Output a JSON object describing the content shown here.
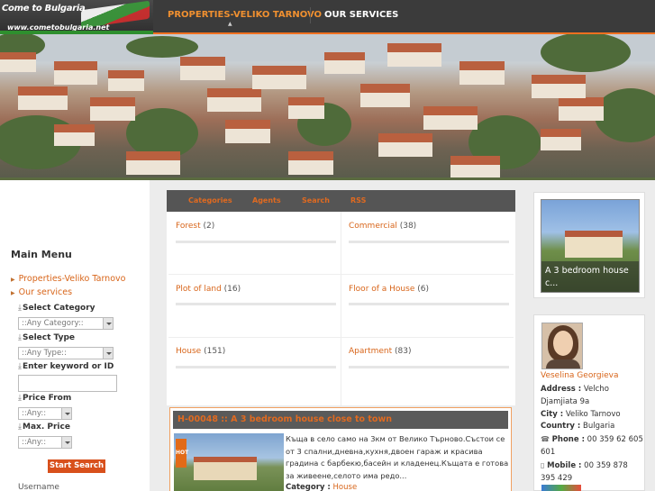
{
  "logo": {
    "line1": "Come to Bulgaria",
    "line2": "www.cometobulgaria.net"
  },
  "nav": {
    "items": [
      "PROPERTIES-VELIKO TARNOVO",
      "OUR SERVICES"
    ]
  },
  "sidebar": {
    "menu_title": "Main Menu",
    "menu_items": [
      "Properties-Veliko Tarnovo",
      "Our services"
    ],
    "search": {
      "category_label": "Select Category",
      "category_value": "::Any Category::",
      "type_label": "Select Type",
      "type_value": "::Any Type::",
      "keyword_label": "Enter keyword or ID",
      "keyword_value": "",
      "price_from_label": "Price From",
      "price_from_value": "::Any::",
      "max_price_label": "Max. Price",
      "max_price_value": "::Any::",
      "submit_label": "Start Search"
    },
    "username_label": "Username"
  },
  "main": {
    "tabs": [
      "Categories",
      "Agents",
      "Search",
      "RSS"
    ],
    "categories": [
      {
        "name": "Forest",
        "count": "(2)"
      },
      {
        "name": "Commercial",
        "count": "(38)"
      },
      {
        "name": "Plot of land",
        "count": "(16)"
      },
      {
        "name": "Floor of a House",
        "count": "(6)"
      },
      {
        "name": "House",
        "count": "(151)"
      },
      {
        "name": "Apartment",
        "count": "(83)"
      }
    ],
    "listing": {
      "title": "H-00048 :: A 3 bedroom house close to town",
      "description": "Къща в село само на 3км от Велико Търново.Състои се от 3 спални,дневна,кухня,двоен гараж и красива градина с барбекю,басейн и кладенец.Къщата е готова за живеене,селото има редо...",
      "category_label": "Category :",
      "category_value": "House",
      "sign_text": "HOT"
    }
  },
  "right": {
    "featured_caption": "A 3 bedroom house c...",
    "agent": {
      "name": "Veselina Georgieva",
      "address_label": "Address :",
      "address_value": "Velcho Djamjiata 9a",
      "city_label": "City :",
      "city_value": "Veliko Tarnovo",
      "country_label": "Country :",
      "country_value": "Bulgaria",
      "phone_label": "Phone :",
      "phone_value": "00 359 62 605 601",
      "mobile_label": "Mobile :",
      "mobile_value": "00 359 878 395 429"
    }
  },
  "colors": {
    "accent": "#d8651a",
    "topbar": "#3b3b3b",
    "button": "#d8501c"
  }
}
